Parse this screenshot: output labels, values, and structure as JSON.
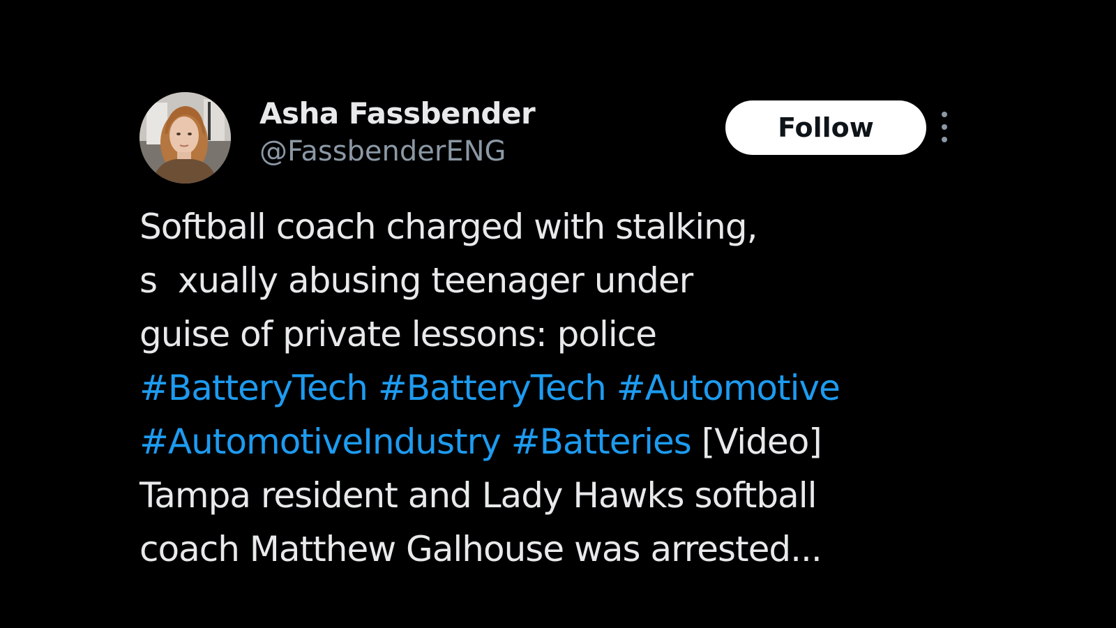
{
  "author": {
    "display_name": "Asha Fassbender",
    "handle": "@FassbenderENG",
    "avatar_icon": "profile-photo"
  },
  "actions": {
    "follow_label": "Follow",
    "more_icon": "more-vertical-icon"
  },
  "tweet": {
    "line1": "Softball coach charged with stalking,",
    "line2": "s  xually abusing teenager under",
    "line3": "guise of private lessons: police",
    "hashtags_line4": [
      "#BatteryTech",
      "#BatteryTech",
      "#Automotive"
    ],
    "hashtags_line5": [
      "#AutomotiveIndustry",
      "#Batteries"
    ],
    "line5_suffix": "[Video]",
    "line6": "Tampa resident and Lady Hawks softball",
    "line7": "coach Matthew Galhouse was arrested..."
  },
  "colors": {
    "background": "#000000",
    "text": "#e7e9ea",
    "secondary": "#8b98a5",
    "link": "#1d9bf0",
    "button_bg": "#ffffff",
    "button_text": "#0f1419"
  }
}
